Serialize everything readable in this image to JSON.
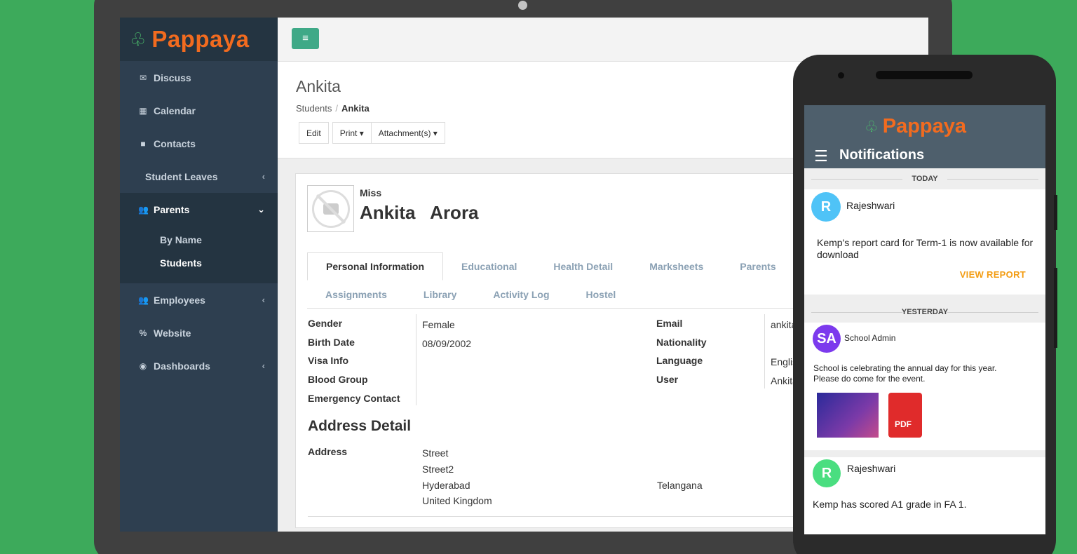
{
  "app": {
    "logo": "Pappaya"
  },
  "sidebar": {
    "items": [
      {
        "label": "Discuss",
        "icon": "envelope-icon"
      },
      {
        "label": "Calendar",
        "icon": "calendar-icon"
      },
      {
        "label": "Contacts",
        "icon": "contact-card-icon"
      },
      {
        "label": "Student Leaves"
      },
      {
        "label": "Parents",
        "icon": "users-icon"
      },
      {
        "label": "Employees",
        "icon": "users-icon"
      },
      {
        "label": "Website",
        "icon": "link-icon"
      },
      {
        "label": "Dashboards",
        "icon": "dashboard-icon"
      }
    ],
    "subitems": [
      "By Name",
      "Students"
    ]
  },
  "page": {
    "title": "Ankita",
    "breadcrumb": {
      "parent": "Students",
      "current": "Ankita"
    },
    "buttons": {
      "edit": "Edit",
      "print": "Print",
      "attachments": "Attachment(s)"
    }
  },
  "record": {
    "salutation": "Miss",
    "name": "Ankita   Arora",
    "tabs_row1": [
      "Personal Information",
      "Educational",
      "Health Detail",
      "Marksheets",
      "Parents"
    ],
    "tabs_row2": [
      "Assignments",
      "Library",
      "Activity Log",
      "Hostel"
    ],
    "left_labels": [
      "Gender",
      "Birth Date",
      "Visa Info",
      "Blood Group",
      "Emergency Contact"
    ],
    "left_values": [
      "Female",
      "08/09/2002"
    ],
    "right_labels": [
      "Email",
      "Nationality",
      "Language",
      "User"
    ],
    "right_values": [
      "ankita",
      "Englis",
      "Ankita"
    ],
    "address_title": "Address Detail",
    "address_label": "Address",
    "address_lines": [
      "Street",
      "Street2",
      "Hyderabad",
      "United Kingdom"
    ],
    "state": "Telangana"
  },
  "phone": {
    "logo": "Pappaya",
    "title": "Notifications",
    "today": "TODAY",
    "yesterday": "YESTERDAY",
    "n1": {
      "initial": "R",
      "sender": "Rajeshwari",
      "message": "Kemp's report card for Term-1 is now available for download",
      "action": "VIEW REPORT"
    },
    "n2": {
      "initial": "SA",
      "sender": "School Admin",
      "message": "School is celebrating the annual day for this year. Please do come for the event.",
      "attachment": "PDF"
    },
    "n3": {
      "initial": "R",
      "sender": "Rajeshwari",
      "message": "Kemp has scored A1 grade in FA 1."
    },
    "colors": {
      "r1": "#4fc3f7",
      "sa": "#7c3aed",
      "r2": "#4ade80"
    }
  }
}
